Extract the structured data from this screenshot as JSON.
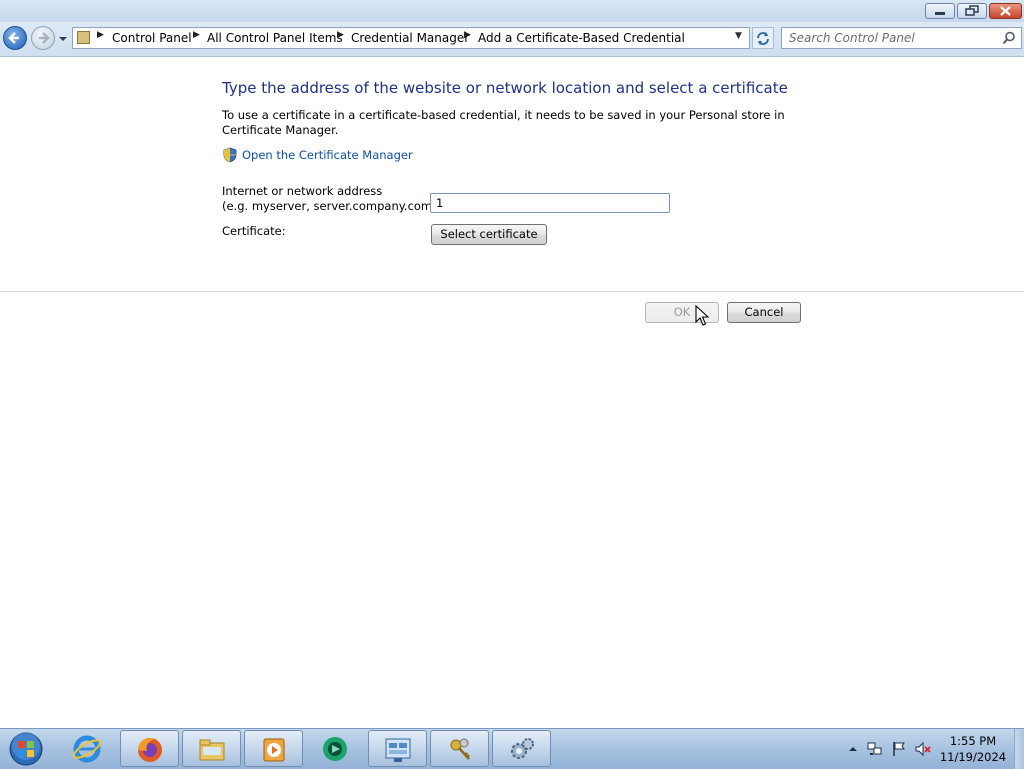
{
  "window": {
    "minimize_label": "0",
    "maximize_label": "1",
    "close_label": "r"
  },
  "nav": {
    "breadcrumbs": [
      "Control Panel",
      "All Control Panel Items",
      "Credential Manager",
      "Add a Certificate-Based Credential"
    ],
    "search_placeholder": "Search Control Panel",
    "refresh_icon": "refresh-icon"
  },
  "content": {
    "title": "Type the address of the website or network location and select a certificate",
    "description": "To use a certificate in a certificate-based credential, it needs to be saved in your Personal store in Certificate Manager.",
    "cert_manager_link": "Open the Certificate Manager",
    "address_label_line1": "Internet or network address",
    "address_label_line2": "(e.g. myserver, server.company.com):",
    "address_value": "1",
    "certificate_label": "Certificate:",
    "select_cert_button": "Select certificate",
    "ok_button": "OK",
    "cancel_button": "Cancel"
  },
  "taskbar": {
    "items": [
      {
        "name": "internet-explorer",
        "active": false
      },
      {
        "name": "firefox",
        "active": true
      },
      {
        "name": "file-explorer",
        "active": true
      },
      {
        "name": "media-player",
        "active": true
      },
      {
        "name": "app-green-circle",
        "active": false
      },
      {
        "name": "control-panel",
        "active": true
      },
      {
        "name": "credential-manager",
        "active": true
      },
      {
        "name": "system-settings",
        "active": true
      }
    ],
    "clock_time": "1:55 PM",
    "clock_date": "11/19/2024"
  },
  "colors": {
    "title_text": "#1e3287",
    "link_text": "#0d4fa5",
    "taskbar": "#a9c4e1"
  }
}
